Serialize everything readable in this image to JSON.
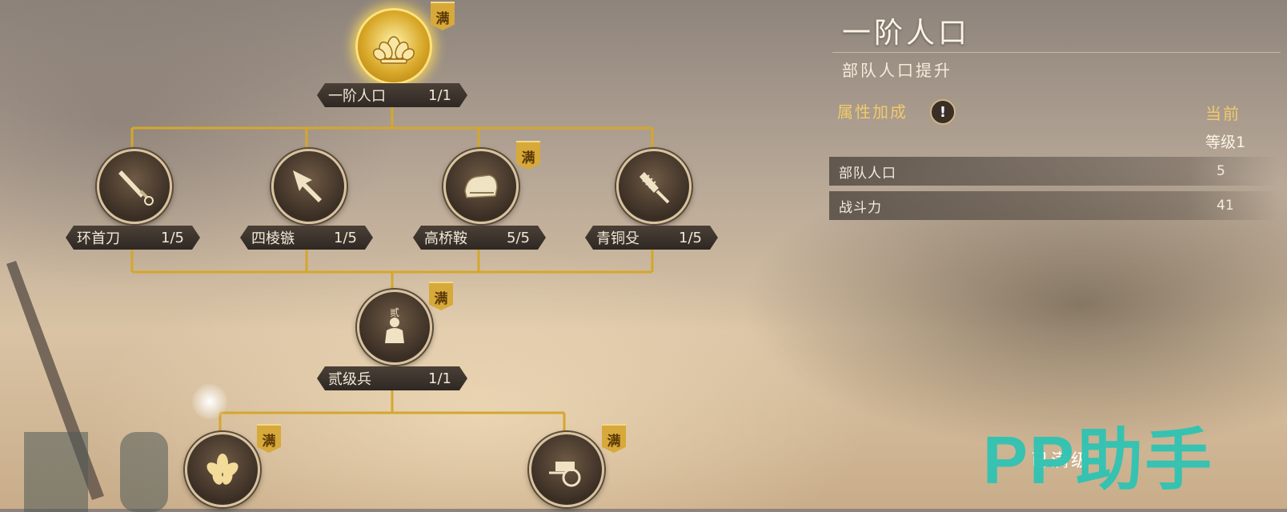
{
  "panel": {
    "title": "一阶人口",
    "subtitle": "部队人口提升",
    "attr_title": "属性加成",
    "info_glyph": "!",
    "current_col": "当前",
    "level_label": "等级1",
    "rows": [
      {
        "key": "部队人口",
        "value": "5"
      },
      {
        "key": "战斗力",
        "value": "41"
      }
    ],
    "maxed_text": "已满级"
  },
  "watermark": "PP助手",
  "badge_text": "满",
  "tree": {
    "root": {
      "name": "一阶人口",
      "progress": "1/1",
      "icon": "lotus-crest-icon"
    },
    "tier1": [
      {
        "name": "环首刀",
        "progress": "1/5",
        "icon": "ring-pommel-sword-icon"
      },
      {
        "name": "四棱镞",
        "progress": "1/5",
        "icon": "arrowhead-icon"
      },
      {
        "name": "高桥鞍",
        "progress": "5/5",
        "icon": "saddle-icon"
      },
      {
        "name": "青铜殳",
        "progress": "1/5",
        "icon": "bronze-mace-icon"
      }
    ],
    "mid": {
      "name": "贰级兵",
      "progress": "1/1",
      "rank_glyph": "贰",
      "icon": "soldier-icon"
    },
    "bottom": [
      {
        "icon": "flower-icon"
      },
      {
        "icon": "chariot-icon"
      }
    ]
  },
  "colors": {
    "gold": "#d7a93a",
    "line": "#d4a72c",
    "teal": "#2fc3b3"
  }
}
